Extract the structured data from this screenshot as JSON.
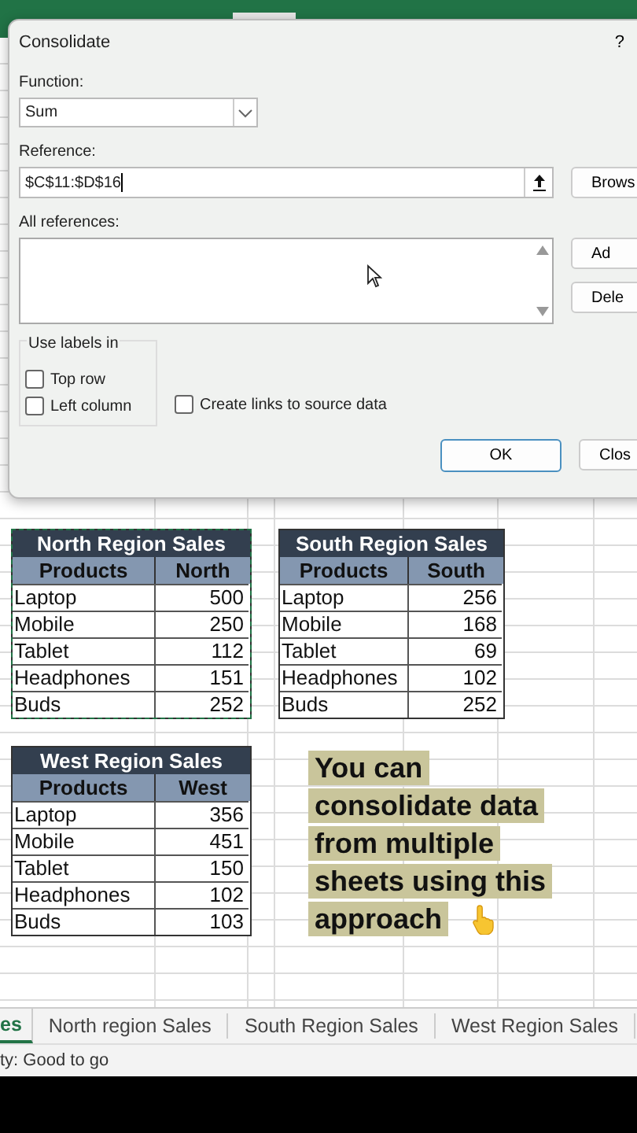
{
  "dialog": {
    "title": "Consolidate",
    "help": "?",
    "function": {
      "label": "Function:",
      "value": "Sum"
    },
    "reference": {
      "label": "Reference:",
      "value": "$C$11:$D$16"
    },
    "all_references": {
      "label": "All references:"
    },
    "side_buttons": [
      "Brows",
      "Ad",
      "Dele"
    ],
    "use_labels": {
      "title": "Use labels in",
      "options": [
        {
          "label": "Top row",
          "checked": false
        },
        {
          "label": "Left column",
          "checked": false
        }
      ]
    },
    "create_links": {
      "label": "Create links to source data",
      "checked": false
    },
    "ok": "OK",
    "close": "Clos"
  },
  "tables": [
    {
      "title": "North Region Sales",
      "selected": true,
      "columns": [
        "Products",
        "North"
      ],
      "rows": [
        [
          "Laptop",
          "500"
        ],
        [
          "Mobile",
          "250"
        ],
        [
          "Tablet",
          "112"
        ],
        [
          "Headphones",
          "151"
        ],
        [
          "Buds",
          "252"
        ]
      ]
    },
    {
      "title": "South Region Sales",
      "selected": false,
      "columns": [
        "Products",
        "South"
      ],
      "rows": [
        [
          "Laptop",
          "256"
        ],
        [
          "Mobile",
          "168"
        ],
        [
          "Tablet",
          "69"
        ],
        [
          "Headphones",
          "102"
        ],
        [
          "Buds",
          "252"
        ]
      ]
    },
    {
      "title": "West Region Sales",
      "selected": false,
      "columns": [
        "Products",
        "West"
      ],
      "rows": [
        [
          "Laptop",
          "356"
        ],
        [
          "Mobile",
          "451"
        ],
        [
          "Tablet",
          "150"
        ],
        [
          "Headphones",
          "102"
        ],
        [
          "Buds",
          "103"
        ]
      ]
    }
  ],
  "caption": {
    "lines": [
      "You can",
      "consolidate data",
      "from multiple",
      "sheets using this",
      "approach"
    ]
  },
  "sheet_tabs": [
    {
      "label": "es",
      "selected": true
    },
    {
      "label": "North region Sales",
      "selected": false
    },
    {
      "label": "South Region Sales",
      "selected": false
    },
    {
      "label": "West Region Sales",
      "selected": false
    }
  ],
  "status_bar": "ty: Good to go"
}
